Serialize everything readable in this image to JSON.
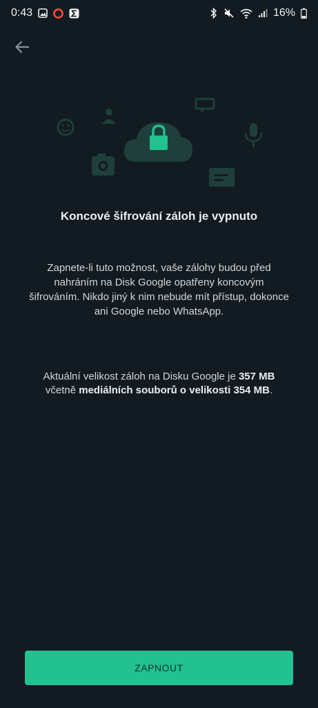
{
  "status_bar": {
    "time": "0:43",
    "battery": "16%",
    "icons_left": [
      "gallery-icon",
      "opera-icon",
      "sigma-app-icon"
    ],
    "icons_right": [
      "bluetooth-icon",
      "mute-icon",
      "wifi-icon",
      "signal-icon",
      "battery-icon"
    ]
  },
  "header": {
    "back_icon": "arrow-left-icon"
  },
  "illustration": {
    "icons": [
      "smiley-icon",
      "camera-icon",
      "contact-icon",
      "chat-icon",
      "cloud-lock-icon",
      "mic-icon",
      "message-icon"
    ],
    "accent": "#21c28f",
    "shape_color": "#1f3f3c"
  },
  "title": "Koncové šifrování záloh je vypnuto",
  "description": "Zapnete-li tuto možnost, vaše zálohy budou před nahráním na Disk Google opatřeny koncovým šifrováním. Nikdo jiný k nim nebude mít přístup, dokonce ani Google nebo WhatsApp.",
  "size_info": {
    "part1": "Aktuální velikost záloh na Disku Google je ",
    "size_total": "357 MB",
    "part2": " včetně ",
    "media_phrase": "mediálních souborů o velikosti 354 MB",
    "part3": "."
  },
  "button": {
    "label": "ZAPNOUT",
    "color": "#21c28f"
  }
}
